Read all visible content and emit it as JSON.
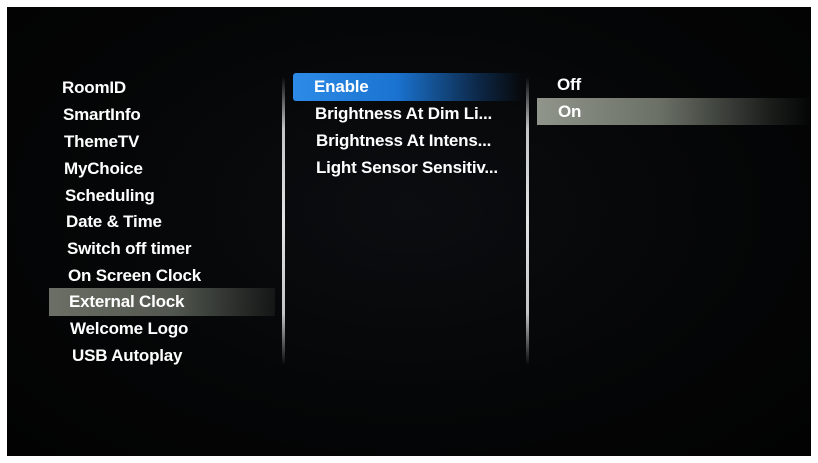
{
  "left_menu": {
    "items": [
      {
        "label": "RoomID"
      },
      {
        "label": "SmartInfo"
      },
      {
        "label": "ThemeTV"
      },
      {
        "label": "MyChoice"
      },
      {
        "label": "Scheduling"
      },
      {
        "label": "Date & Time"
      },
      {
        "label": "Switch off timer"
      },
      {
        "label": "On Screen Clock"
      },
      {
        "label": "External Clock"
      },
      {
        "label": "Welcome Logo"
      },
      {
        "label": "USB Autoplay"
      }
    ],
    "selected": "External Clock"
  },
  "middle_menu": {
    "items": [
      {
        "label": "Enable"
      },
      {
        "label": "Brightness At Dim Li..."
      },
      {
        "label": "Brightness At Intens..."
      },
      {
        "label": "Light Sensor Sensitiv..."
      }
    ],
    "focused": "Enable"
  },
  "right_menu": {
    "items": [
      {
        "label": "Off"
      },
      {
        "label": "On"
      }
    ],
    "selected": "On"
  },
  "colors": {
    "focus_highlight": "#1f7fdc",
    "selection_highlight": "#6b6f66",
    "text": "#ffffff",
    "background": "#050607"
  }
}
